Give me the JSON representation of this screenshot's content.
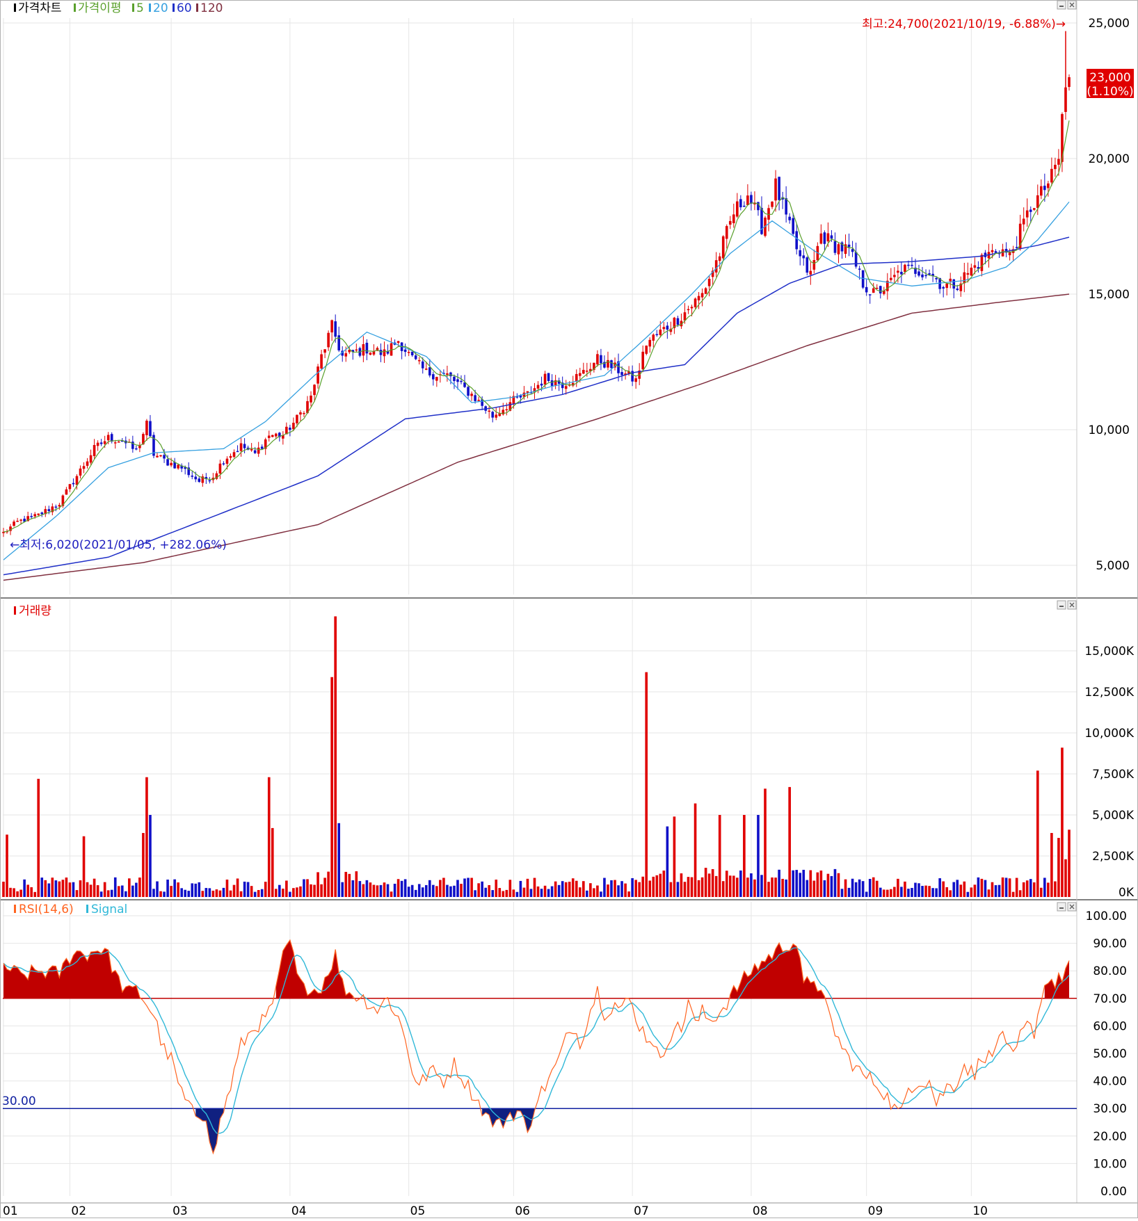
{
  "colors": {
    "up": "#e00000",
    "down": "#1010c8",
    "ma5": "#5aa02c",
    "ma20": "#35a0e0",
    "ma60": "#2030c8",
    "ma120": "#803040",
    "rsi": "#ff6420",
    "signal": "#30b8d8",
    "grid": "#e6e6e6",
    "annotation_high": "#e00000",
    "annotation_low": "#2020c0",
    "rsi_fill_high": "#c00000",
    "rsi_fill_low": "#102080"
  },
  "price_pane": {
    "legend": [
      {
        "label": "가격차트",
        "color": "#000000"
      },
      {
        "label": "가격이평",
        "color": "#5aa02c"
      },
      {
        "label": "5",
        "color": "#5aa02c"
      },
      {
        "label": "20",
        "color": "#35a0e0"
      },
      {
        "label": "60",
        "color": "#2030c8"
      },
      {
        "label": "120",
        "color": "#803040"
      }
    ],
    "y_ticks": [
      "25,000",
      "20,000",
      "15,000",
      "10,000",
      "5,000"
    ],
    "high_annotation": "최고:24,700(2021/10/19, -6.88%)→",
    "low_annotation": "←최저:6,020(2021/01/05, +282.06%)",
    "last_price_label": "23,000",
    "last_change_label": "(1.10%)"
  },
  "volume_pane": {
    "legend": "거래량",
    "y_ticks": [
      "15,000K",
      "12,500K",
      "10,000K",
      "7,500K",
      "5,000K",
      "2,500K",
      "0K"
    ]
  },
  "rsi_pane": {
    "legend_rsi": "RSI(14,6)",
    "legend_signal": "Signal",
    "y_ticks": [
      "100.00",
      "90.00",
      "80.00",
      "70.00",
      "60.00",
      "50.00",
      "40.00",
      "30.00",
      "20.00",
      "10.00",
      "0.00"
    ],
    "line_30_label": "30.00"
  },
  "x_axis": {
    "month_labels": [
      "01",
      "02",
      "03",
      "04",
      "05",
      "06",
      "07",
      "08",
      "09",
      "10"
    ]
  },
  "chart_data": {
    "type": "candlestick",
    "period": "2021-01 to 2021-10 (daily)",
    "price_axis_range": [
      4000,
      25800
    ],
    "volume_axis_range_k": [
      0,
      17000
    ],
    "rsi_axis_range": [
      0,
      100
    ],
    "rsi_reference_lines": [
      70,
      30
    ],
    "high": {
      "value": 24700,
      "date": "2021/10/19",
      "change_pct": -6.88
    },
    "low": {
      "value": 6020,
      "date": "2021/01/05",
      "change_pct": 282.06
    },
    "last": {
      "value": 23000,
      "change_pct": 1.1
    },
    "ma_anchor_points": {
      "ma20": [
        [
          0,
          5200
        ],
        [
          15,
          6800
        ],
        [
          30,
          8600
        ],
        [
          43,
          9150
        ],
        [
          63,
          9300
        ],
        [
          75,
          10300
        ],
        [
          89,
          12000
        ],
        [
          104,
          13600
        ],
        [
          121,
          12700
        ],
        [
          134,
          11000
        ],
        [
          146,
          11200
        ],
        [
          157,
          11600
        ],
        [
          172,
          12000
        ],
        [
          184,
          13400
        ],
        [
          197,
          15000
        ],
        [
          208,
          16500
        ],
        [
          220,
          17700
        ],
        [
          232,
          16600
        ],
        [
          245,
          15600
        ],
        [
          260,
          15300
        ],
        [
          275,
          15500
        ],
        [
          287,
          16000
        ],
        [
          296,
          17000
        ],
        [
          305,
          18400
        ]
      ],
      "ma60": [
        [
          0,
          4650
        ],
        [
          30,
          5300
        ],
        [
          60,
          6800
        ],
        [
          90,
          8300
        ],
        [
          115,
          10400
        ],
        [
          140,
          10800
        ],
        [
          160,
          11300
        ],
        [
          180,
          12100
        ],
        [
          195,
          12400
        ],
        [
          210,
          14300
        ],
        [
          225,
          15400
        ],
        [
          240,
          16100
        ],
        [
          260,
          16200
        ],
        [
          280,
          16400
        ],
        [
          296,
          16800
        ],
        [
          305,
          17100
        ]
      ],
      "ma120": [
        [
          0,
          4450
        ],
        [
          40,
          5100
        ],
        [
          90,
          6500
        ],
        [
          130,
          8800
        ],
        [
          170,
          10400
        ],
        [
          200,
          11700
        ],
        [
          230,
          13100
        ],
        [
          260,
          14300
        ],
        [
          285,
          14700
        ],
        [
          305,
          15000
        ]
      ]
    },
    "volume_spikes_k": [
      {
        "month": "01",
        "value": 7200
      },
      {
        "month": "02",
        "value": 7300
      },
      {
        "month": "03",
        "value": 7300
      },
      {
        "month": "04",
        "value": 17100
      },
      {
        "month": "04",
        "value": 13400
      },
      {
        "month": "06",
        "value": 13700
      },
      {
        "month": "07",
        "value": 6600
      },
      {
        "month": "08",
        "value": 6700
      },
      {
        "month": "10",
        "value": 7700
      },
      {
        "month": "10",
        "value": 9100
      }
    ]
  }
}
